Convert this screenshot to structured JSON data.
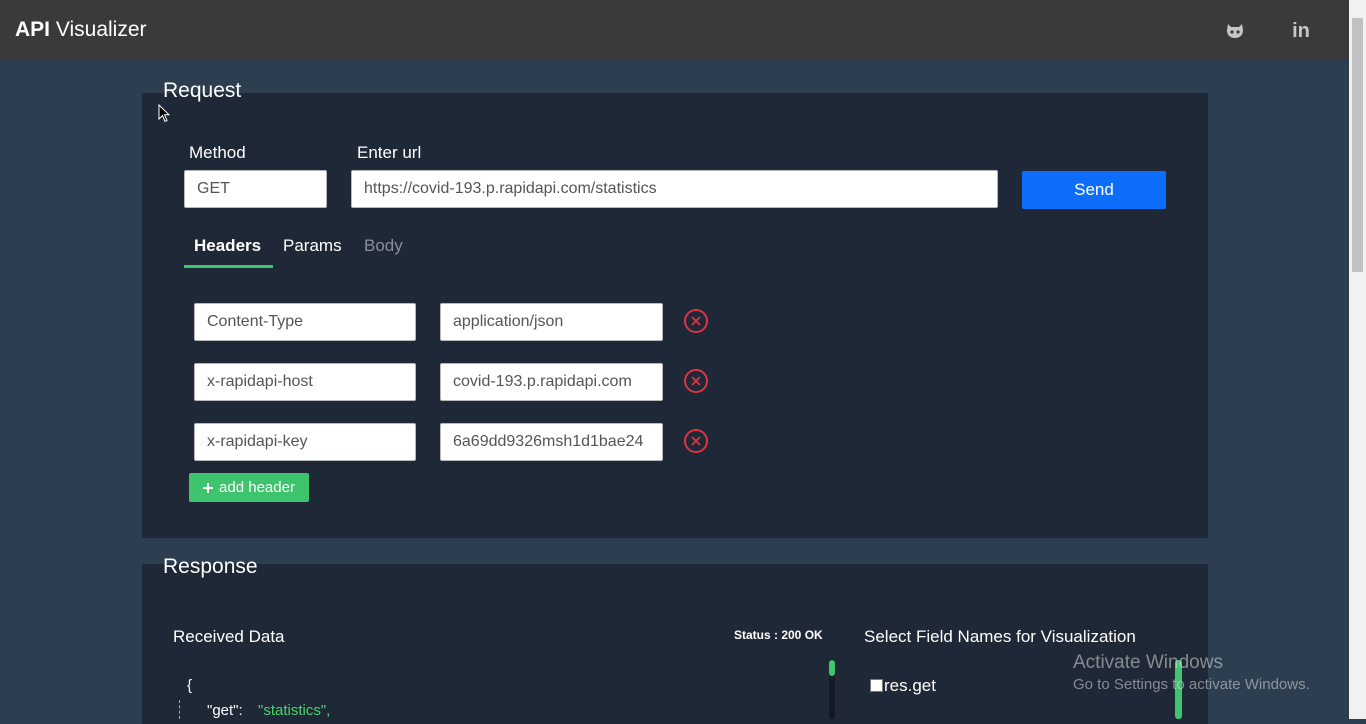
{
  "navbar": {
    "brand_bold": "API",
    "brand_rest": " Visualizer",
    "github_icon": "github-icon",
    "linkedin_icon": "linkedin-icon",
    "linkedin_text": "in"
  },
  "request": {
    "title": "Request",
    "method_label": "Method",
    "method_value": "GET",
    "url_label": "Enter url",
    "url_value": "https://covid-193.p.rapidapi.com/statistics",
    "send_label": "Send",
    "tabs": [
      {
        "label": "Headers",
        "active": true
      },
      {
        "label": "Params",
        "active": false
      },
      {
        "label": "Body",
        "active": false
      }
    ],
    "headers": [
      {
        "key": "Content-Type",
        "value": "application/json"
      },
      {
        "key": "x-rapidapi-host",
        "value": "covid-193.p.rapidapi.com"
      },
      {
        "key": "x-rapidapi-key",
        "value": "6a69dd9326msh1d1bae24"
      }
    ],
    "add_header_label": "add header",
    "add_header_icon": "plus-icon"
  },
  "response": {
    "title": "Response",
    "received_label": "Received Data",
    "status_text": "Status : 200 OK",
    "select_label": "Select Field Names for Visualization",
    "json_open": "{",
    "json_key": "\"get\":",
    "json_value": "\"statistics\",",
    "field_option": "res.get"
  },
  "os_overlay": {
    "line1": "Activate Windows",
    "line2": "Go to Settings to activate Windows."
  },
  "colors": {
    "navbar": "#3a3a3b",
    "background": "#2c3e50",
    "panel": "#1e2836",
    "primary": "#0d6efd",
    "success": "#3ec46d",
    "danger": "#dc3545"
  }
}
